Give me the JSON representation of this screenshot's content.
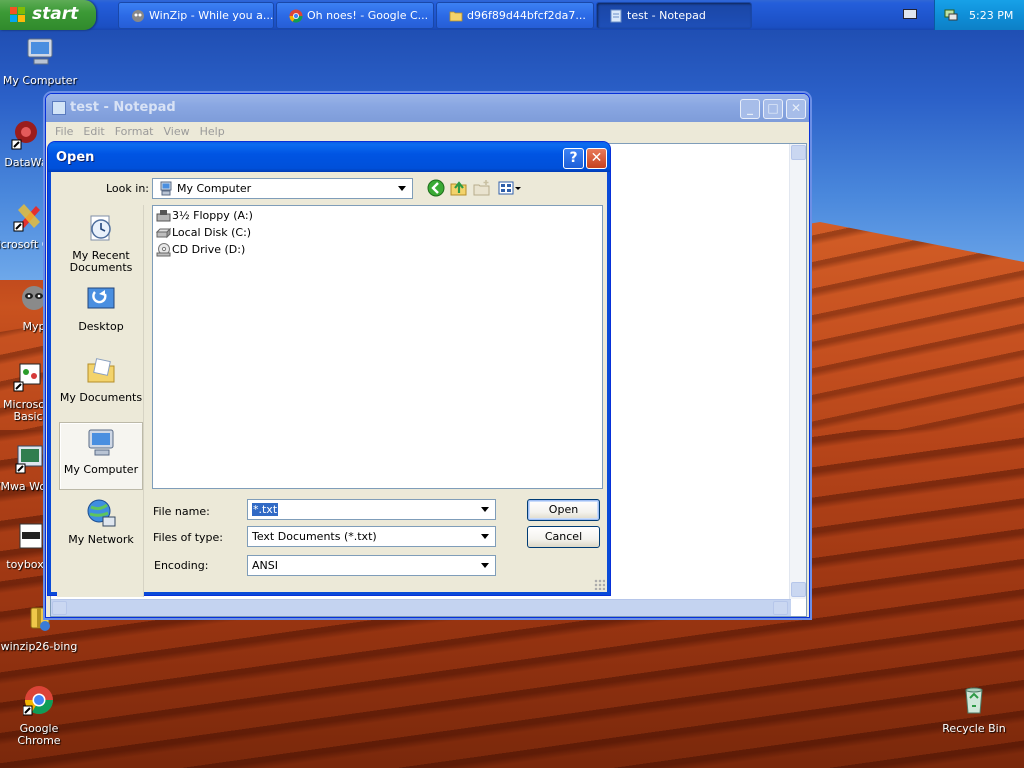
{
  "taskbar": {
    "start_label": "start",
    "buttons": [
      {
        "label": "WinZip - While you a...",
        "icon": "winzip-icon"
      },
      {
        "label": "Oh noes! - Google C...",
        "icon": "chrome-icon"
      },
      {
        "label": "d96f89d44bfcf2da7...",
        "icon": "folder-icon"
      },
      {
        "label": "test - Notepad",
        "icon": "notepad-icon"
      }
    ],
    "clock": "5:23 PM"
  },
  "desktop_icons": [
    {
      "label": "My Computer"
    },
    {
      "label": "DataWa"
    },
    {
      "label": "Microsoft C++"
    },
    {
      "label": "Myp"
    },
    {
      "label": "Microsoft Basic"
    },
    {
      "label": "VMwa Workst"
    },
    {
      "label": "toybox-c"
    },
    {
      "label": "winzip26-bing"
    },
    {
      "label": "Google Chrome"
    },
    {
      "label": "Recycle Bin"
    }
  ],
  "notepad": {
    "title": "test - Notepad",
    "menu": [
      "File",
      "Edit",
      "Format",
      "View",
      "Help"
    ]
  },
  "dialog": {
    "title": "Open",
    "look_in_label": "Look in:",
    "look_in_value": "My Computer",
    "places": [
      {
        "label": "My Recent Documents"
      },
      {
        "label": "Desktop"
      },
      {
        "label": "My Documents"
      },
      {
        "label": "My Computer"
      },
      {
        "label": "My Network"
      }
    ],
    "items": [
      {
        "label": "3½ Floppy (A:)",
        "icon": "floppy-icon"
      },
      {
        "label": "Local Disk (C:)",
        "icon": "hard-disk-icon"
      },
      {
        "label": "CD Drive (D:)",
        "icon": "cd-drive-icon"
      }
    ],
    "file_name_label": "File name:",
    "file_name_value": "*.txt",
    "files_of_type_label": "Files of type:",
    "files_of_type_value": "Text Documents (*.txt)",
    "encoding_label": "Encoding:",
    "encoding_value": "ANSI",
    "open_button": "Open",
    "cancel_button": "Cancel",
    "help_button": "?",
    "close_button": "✕"
  }
}
